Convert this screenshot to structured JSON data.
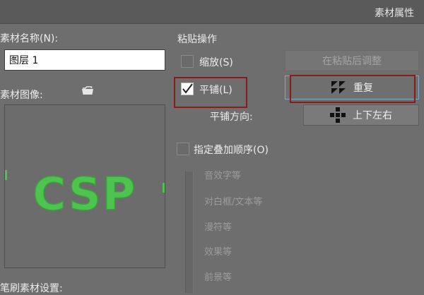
{
  "window": {
    "title": "素材属性"
  },
  "left": {
    "name_label": "素材名称(N):",
    "name_value": "图层 1",
    "image_label": "素材图像:",
    "preview_text": "CSP",
    "brush_label": "笔刷素材设置:"
  },
  "paste": {
    "section_label": "粘贴操作",
    "scale_label": "缩放(S)",
    "scale_checked": false,
    "adjust_button": "在粘贴后调整",
    "tile_label": "平铺(L)",
    "tile_checked": true,
    "repeat_button": "重复",
    "tile_dir_label": "平铺方向:",
    "tile_dir_button": "上下左右",
    "order_label": "指定叠加顺序(O)",
    "order_checked": false,
    "order_items": [
      "音效字等",
      "对白框/文本等",
      "漫符等",
      "效果等",
      "前景等"
    ]
  },
  "colors": {
    "highlight": "#8b1a1a",
    "preview_green": "#4fc34f"
  }
}
